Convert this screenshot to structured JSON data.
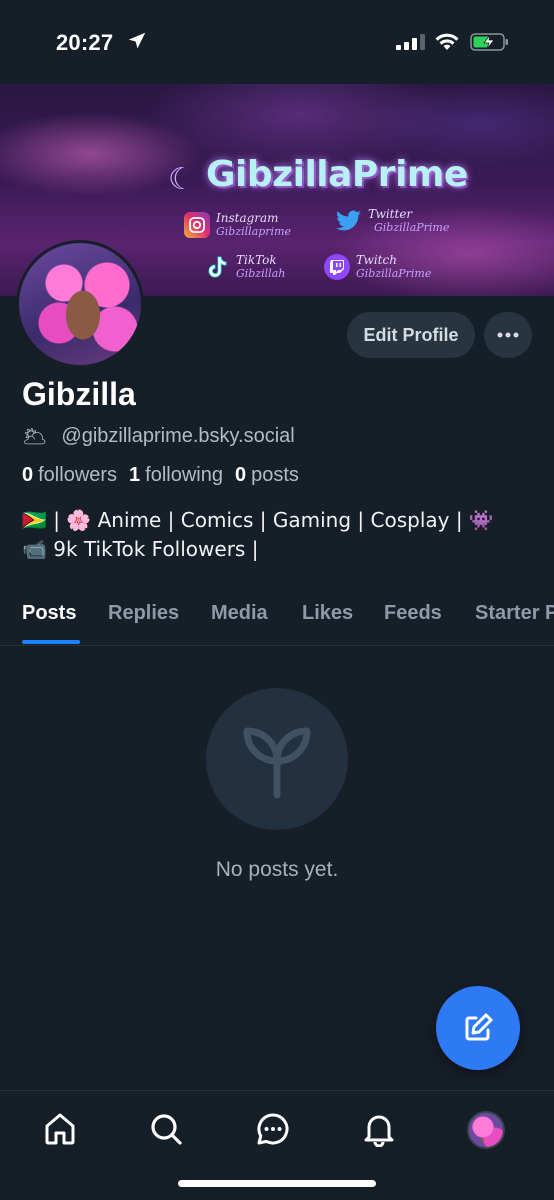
{
  "status": {
    "time": "20:27"
  },
  "banner": {
    "title": "GibzillaPrime",
    "socials": [
      {
        "platform": "Instagram",
        "handle": "Gibzillaprime",
        "icon": "instagram-icon"
      },
      {
        "platform": "Twitter",
        "handle": "GibzillaPrime",
        "icon": "twitter-icon"
      },
      {
        "platform": "TikTok",
        "handle": "Gibzillah",
        "icon": "tiktok-icon"
      },
      {
        "platform": "Twitch",
        "handle": "GibzillaPrime",
        "icon": "twitch-icon"
      }
    ]
  },
  "profile": {
    "display_name": "Gibzilla",
    "handle_emoji": "🌥",
    "handle": "@gibzillaprime.bsky.social",
    "followers_count": "0",
    "followers_label": "followers",
    "following_count": "1",
    "following_label": "following",
    "posts_count": "0",
    "posts_label": "posts",
    "bio_line1": "🇬🇾 | 🌸 Anime | Comics | Gaming | Cosplay | 👾",
    "bio_line2": "📹 9k TikTok Followers |"
  },
  "actions": {
    "edit_profile": "Edit Profile",
    "more": "···"
  },
  "tabs": [
    "Posts",
    "Replies",
    "Media",
    "Likes",
    "Feeds",
    "Starter Packs"
  ],
  "active_tab": "Posts",
  "empty_state": {
    "message": "No posts yet."
  },
  "colors": {
    "background": "#161e27",
    "accent": "#1d84ff",
    "fab": "#2e7af5",
    "button": "#293441"
  }
}
